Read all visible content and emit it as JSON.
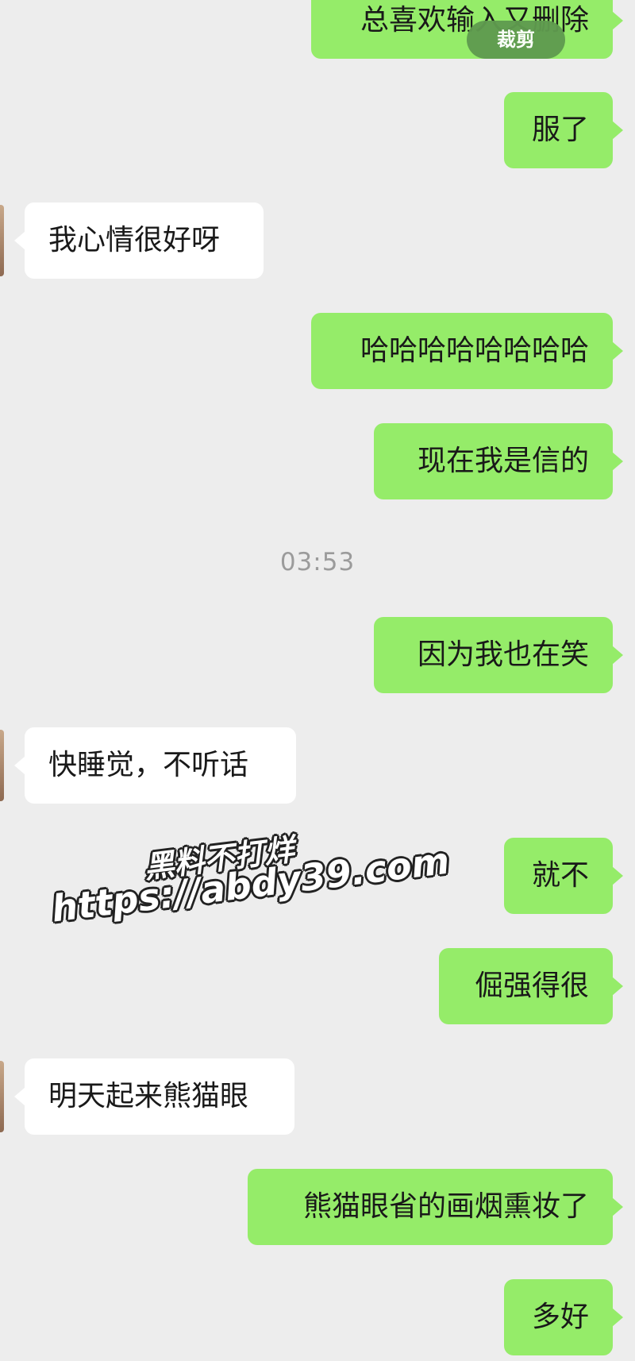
{
  "chat": {
    "messages": [
      {
        "side": "sent",
        "text": "总喜欢输入又删除"
      },
      {
        "side": "sent",
        "text": "服了"
      },
      {
        "side": "received",
        "text": "我心情很好呀"
      },
      {
        "side": "sent",
        "text": "哈哈哈哈哈哈哈哈"
      },
      {
        "side": "sent",
        "text": "现在我是信的"
      },
      {
        "side": "sent",
        "text": "因为我也在笑"
      },
      {
        "side": "received",
        "text": "快睡觉，不听话"
      },
      {
        "side": "sent",
        "text": "就不"
      },
      {
        "side": "sent",
        "text": "倔强得很"
      },
      {
        "side": "received",
        "text": "明天起来熊猫眼"
      },
      {
        "side": "sent",
        "text": "熊猫眼省的画烟熏妆了"
      },
      {
        "side": "sent",
        "text": "多好"
      }
    ],
    "timestamp": "03:53"
  },
  "overlay": {
    "crop_label": "裁剪"
  },
  "watermark": {
    "line1": "黑料不打烊",
    "line2": "https://abdy39.com"
  },
  "colors": {
    "background": "#ededed",
    "sent_bubble": "#95ec69",
    "received_bubble": "#ffffff",
    "timestamp": "#9b9b9b"
  }
}
